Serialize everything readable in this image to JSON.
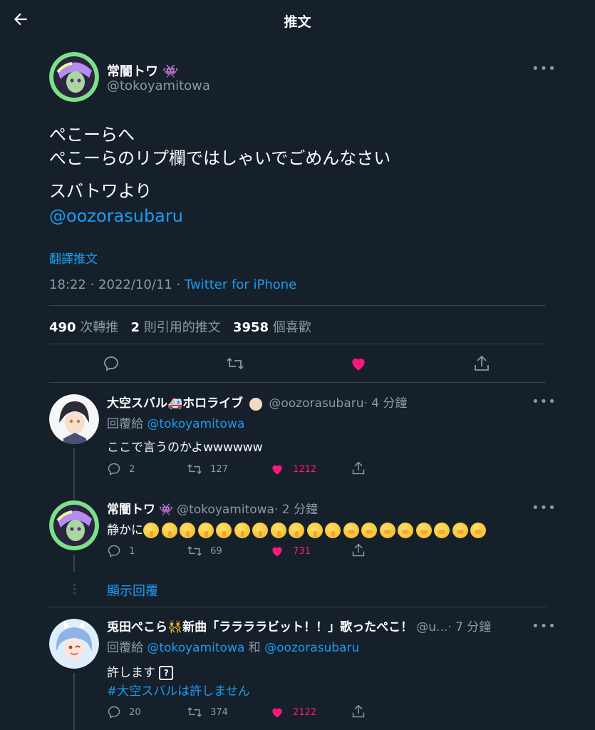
{
  "header": {
    "title": "推文"
  },
  "main_tweet": {
    "name": "常闇トワ",
    "handle": "@tokoyamitowa",
    "lines": [
      "ぺこーらへ",
      "ぺこーらのリプ欄ではしゃいでごめんなさい",
      "スバトワより"
    ],
    "mention": "@oozorasubaru",
    "translate": "翻譯推文",
    "timestamp": "18:22 · 2022/10/11 · ",
    "source": "Twitter for iPhone",
    "stats": {
      "retweets": "490",
      "retweets_label": "次轉推",
      "quotes": "2",
      "quotes_label": "則引用的推文",
      "likes": "3958",
      "likes_label": "個喜歡"
    }
  },
  "replies": [
    {
      "name": "大空スバル🚑ホロライブ",
      "handle": "@oozorasubaru",
      "time": "· 4 分鐘",
      "reply_to_prefix": "回覆給 ",
      "reply_to": "@tokoyamitowa",
      "text": "ここで言うのかよwwwwww",
      "replies": "2",
      "retweets": "127",
      "likes": "1212"
    },
    {
      "name": "常闇トワ",
      "handle": "@tokoyamitowa",
      "time": "· 2 分鐘",
      "text_prefix": "静かに",
      "replies": "1",
      "retweets": "69",
      "likes": "731"
    },
    {
      "name": "兎田ぺこら👯新曲「ララララビット！！」歌ったぺこ！",
      "handle": "@u...",
      "time": "· 7 分鐘",
      "reply_to_prefix": "回覆給 ",
      "reply_to": "@tokoyamitowa",
      "reply_and": " 和 ",
      "reply_to2": "@oozorasubaru",
      "text": "許します",
      "hashtag": "#大空スバルは許しません",
      "replies": "20",
      "retweets": "374",
      "likes": "2122"
    }
  ],
  "show_replies": "顯示回覆",
  "colors": {
    "background": "#15202b",
    "link": "#1d9bf0",
    "like": "#f91880",
    "muted": "#8b98a5"
  },
  "icons": [
    "back-arrow-icon",
    "more-icon",
    "reply-icon",
    "retweet-icon",
    "heart-icon",
    "share-icon"
  ]
}
